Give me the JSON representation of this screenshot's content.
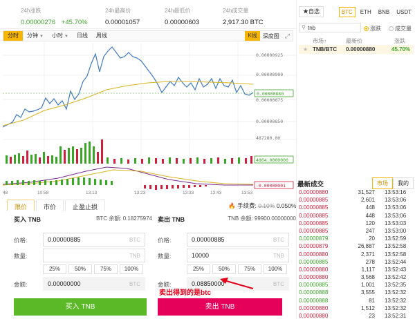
{
  "header": {
    "stats": [
      {
        "label": "24h涨跌",
        "value": "0.00000276",
        "change": "+45.70%"
      },
      {
        "label": "24h最高价",
        "value": "0.00001057"
      },
      {
        "label": "24h最低价",
        "value": "0.00000603"
      },
      {
        "label": "24h成交量",
        "value": "2,917.30 BTC"
      }
    ]
  },
  "toolbar": {
    "intervals": [
      "分时",
      "分钟",
      "小时",
      "日线",
      "周线"
    ],
    "kline_label": "K线",
    "depth_label": "深度图",
    "fullscreen_icon": "⤢"
  },
  "chart": {
    "y_ticks": [
      "0.00000925",
      "0.00000900",
      "0.00000880",
      "0.00000875",
      "0.00000850"
    ],
    "current_price_label": "0.00000880",
    "volume_ticks": [
      "487280.00",
      "4864.0000000"
    ],
    "macd_label": "-0.00000001",
    "x_ticks": [
      "48",
      "10:58",
      "13:13",
      "13:23",
      "13:33",
      "13:43",
      "13:53"
    ]
  },
  "order_tabs": [
    "限价",
    "市价",
    "止盈止损"
  ],
  "fee": {
    "label": "手续费:",
    "old": "0.10%",
    "new": "0.050%"
  },
  "buy": {
    "title": "买入 TNB",
    "balance": "BTC 余额: 0.18275974",
    "price_label": "价格:",
    "price_value": "0.00000885",
    "price_unit": "BTC",
    "qty_label": "数量:",
    "qty_value": "",
    "qty_unit": "TNB",
    "percents": [
      "25%",
      "50%",
      "75%",
      "100%"
    ],
    "amount_label": "金额:",
    "amount_value": "0.00000000",
    "amount_unit": "BTC",
    "button": "买入 TNB"
  },
  "sell": {
    "title": "卖出 TNB",
    "balance": "TNB 余额: 99900.00000000",
    "price_label": "价格:",
    "price_value": "0.00000885",
    "price_unit": "BTC",
    "qty_label": "数量:",
    "qty_value": "10000",
    "qty_unit": "TNB",
    "percents": [
      "25%",
      "50%",
      "75%",
      "100%"
    ],
    "amount_label": "金额:",
    "amount_value": "0.08850000",
    "amount_unit": "BTC",
    "button": "卖出 TNB"
  },
  "annotation": "卖出得到的是btc",
  "market": {
    "fav_label": "★自选",
    "tabs": [
      "BTC",
      "ETH",
      "BNB",
      "USDT"
    ],
    "search_value": "tnb",
    "radio_change": "涨跌",
    "radio_volume": "成交量",
    "col_market": "市场↑",
    "col_price": "最新价",
    "col_change": "涨跌",
    "pair": {
      "name": "TNB/BTC",
      "price": "0.00000880",
      "change": "45.70%"
    }
  },
  "trades": {
    "title": "最新成交",
    "tab_market": "市场",
    "tab_mine": "我的",
    "rows": [
      {
        "price": "0.00000880",
        "qty": "31,527",
        "time": "13:53:16",
        "side": "red"
      },
      {
        "price": "0.00000885",
        "qty": "2,601",
        "time": "13:53:06",
        "side": "red"
      },
      {
        "price": "0.00000885",
        "qty": "448",
        "time": "13:53:06",
        "side": "red"
      },
      {
        "price": "0.00000885",
        "qty": "448",
        "time": "13:53:06",
        "side": "red"
      },
      {
        "price": "0.00000885",
        "qty": "120",
        "time": "13:53:03",
        "side": "red"
      },
      {
        "price": "0.00000885",
        "qty": "247",
        "time": "13:53:00",
        "side": "red"
      },
      {
        "price": "0.00000879",
        "qty": "20",
        "time": "13:52:59",
        "side": "green"
      },
      {
        "price": "0.00000879",
        "qty": "26,887",
        "time": "13:52:58",
        "side": "red"
      },
      {
        "price": "0.00000880",
        "qty": "2,371",
        "time": "13:52:58",
        "side": "red"
      },
      {
        "price": "0.00000885",
        "qty": "278",
        "time": "13:52:44",
        "side": "green"
      },
      {
        "price": "0.00000880",
        "qty": "1,117",
        "time": "13:52:43",
        "side": "red"
      },
      {
        "price": "0.00000880",
        "qty": "3,568",
        "time": "13:52:42",
        "side": "red"
      },
      {
        "price": "0.00000885",
        "qty": "1,001",
        "time": "13:52:35",
        "side": "green"
      },
      {
        "price": "0.00000888",
        "qty": "3,555",
        "time": "13:52:32",
        "side": "green"
      },
      {
        "price": "0.00000888",
        "qty": "81",
        "time": "13:52:32",
        "side": "green"
      },
      {
        "price": "0.00000880",
        "qty": "1,512",
        "time": "13:52:32",
        "side": "red"
      },
      {
        "price": "0.00000880",
        "qty": "23",
        "time": "13:52:31",
        "side": "red"
      }
    ]
  }
}
